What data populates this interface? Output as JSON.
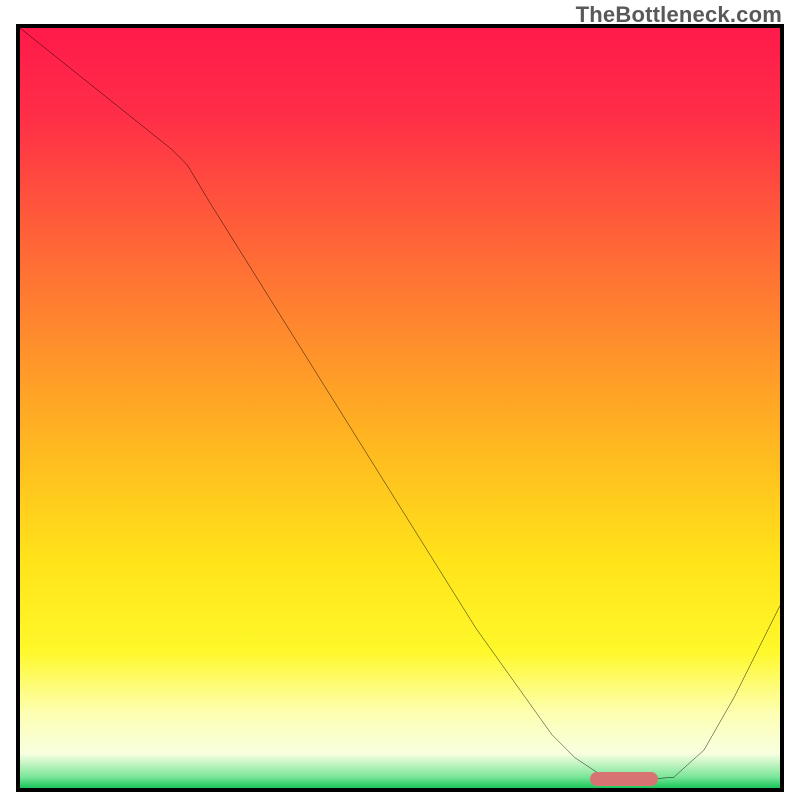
{
  "watermark": "TheBottleneck.com",
  "chart_data": {
    "type": "line",
    "title": "",
    "xlabel": "",
    "ylabel": "",
    "xlim": [
      0,
      100
    ],
    "ylim": [
      0,
      100
    ],
    "x": [
      0,
      5,
      10,
      15,
      20,
      22,
      25,
      30,
      35,
      40,
      45,
      50,
      55,
      60,
      65,
      70,
      73,
      76,
      80,
      83,
      86,
      90,
      94,
      97,
      100
    ],
    "values": [
      100,
      96,
      92,
      88,
      84,
      82,
      77,
      69,
      61,
      53,
      45,
      37,
      29,
      21,
      14,
      7,
      4,
      2,
      1.2,
      1.2,
      1.4,
      5,
      12,
      18,
      24
    ],
    "gradient_stops": [
      {
        "pos": 0.0,
        "color": "#ff1a4b"
      },
      {
        "pos": 0.12,
        "color": "#ff2f47"
      },
      {
        "pos": 0.25,
        "color": "#ff5a3a"
      },
      {
        "pos": 0.4,
        "color": "#ff8a2d"
      },
      {
        "pos": 0.55,
        "color": "#ffb820"
      },
      {
        "pos": 0.7,
        "color": "#ffe31a"
      },
      {
        "pos": 0.82,
        "color": "#fff82a"
      },
      {
        "pos": 0.9,
        "color": "#fdffb0"
      },
      {
        "pos": 0.955,
        "color": "#f8ffe0"
      },
      {
        "pos": 0.985,
        "color": "#7de69a"
      },
      {
        "pos": 1.0,
        "color": "#18c65a"
      }
    ],
    "marker": {
      "x_start": 75,
      "x_end": 84,
      "y": 1.2
    }
  }
}
